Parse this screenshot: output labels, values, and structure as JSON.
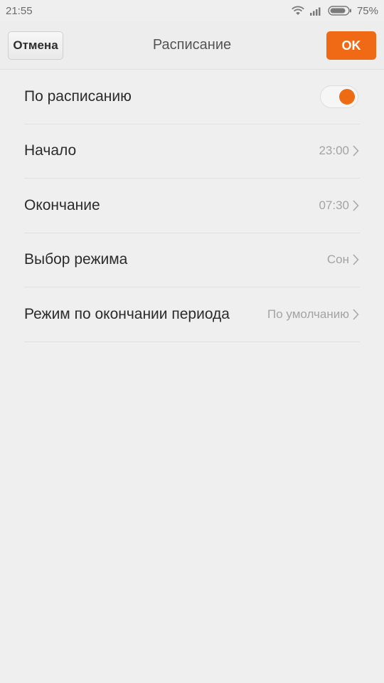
{
  "status_bar": {
    "time": "21:55",
    "battery_percent": "75%",
    "icons": [
      "wifi-icon",
      "signal-icon",
      "battery-icon"
    ]
  },
  "header": {
    "cancel_label": "Отмена",
    "title": "Расписание",
    "ok_label": "OK"
  },
  "settings": {
    "items": [
      {
        "label": "По расписанию",
        "toggle_on": true
      },
      {
        "label": "Начало",
        "value": "23:00"
      },
      {
        "label": "Окончание",
        "value": "07:30"
      },
      {
        "label": "Выбор режима",
        "value": "Сон"
      },
      {
        "label": "Режим по окончании периода",
        "value": "По умолчанию"
      }
    ]
  },
  "colors": {
    "accent": "#f06a15",
    "background": "#f0efef",
    "text_primary": "#2b2b2b",
    "text_secondary": "#a3a3a3"
  }
}
